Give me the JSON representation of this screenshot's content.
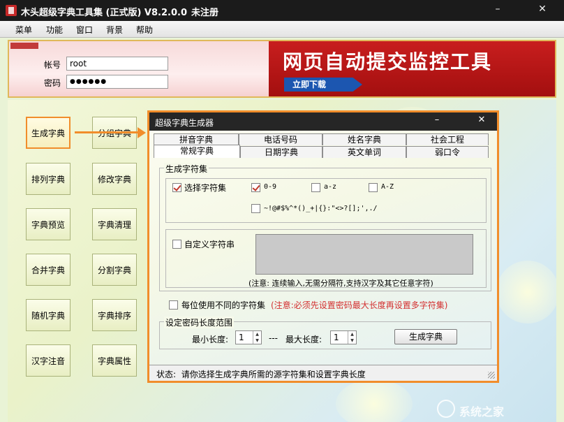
{
  "window": {
    "title": "木头超级字典工具集 (正式版) V8.2.0.0",
    "registration": "未注册",
    "min_icon": "minimize-icon",
    "close_icon": "close-icon"
  },
  "menu": {
    "items": [
      {
        "label": "菜单"
      },
      {
        "label": "功能"
      },
      {
        "label": "窗口"
      },
      {
        "label": "背景"
      },
      {
        "label": "帮助"
      }
    ]
  },
  "login": {
    "account_label": "帐号",
    "account_value": "root",
    "password_label": "密码",
    "password_value": "●●●●●●"
  },
  "ad": {
    "headline": "网页自动提交监控工具",
    "download_label": "立即下载"
  },
  "sidebar": {
    "left": [
      {
        "label": "生成字典",
        "active": true
      },
      {
        "label": "排列字典"
      },
      {
        "label": "字典预览"
      },
      {
        "label": "合并字典"
      },
      {
        "label": "随机字典"
      },
      {
        "label": "汉字注音"
      }
    ],
    "right": [
      {
        "label": "分组字典"
      },
      {
        "label": "修改字典"
      },
      {
        "label": "字典清理"
      },
      {
        "label": "分割字典"
      },
      {
        "label": "字典排序"
      },
      {
        "label": "字典属性"
      }
    ]
  },
  "dialog": {
    "title": "超级字典生成器",
    "tabs_row1": [
      {
        "label": "拼音字典"
      },
      {
        "label": "电话号码"
      },
      {
        "label": "姓名字典"
      },
      {
        "label": "社会工程"
      }
    ],
    "tabs_row2": [
      {
        "label": "常规字典",
        "active": true
      },
      {
        "label": "日期字典"
      },
      {
        "label": "英文单词"
      },
      {
        "label": "弱口令"
      }
    ],
    "charset_group": {
      "title": "生成字符集",
      "select_label": "选择字符集",
      "select_checked": true,
      "options": [
        {
          "label": "0-9",
          "checked": true
        },
        {
          "label": "a-z",
          "checked": false
        },
        {
          "label": "A-Z",
          "checked": false
        }
      ],
      "symbols": {
        "label": "~!@#$%^*()_+|{}:\"<>?[];',./",
        "checked": false
      },
      "custom_label": "自定义字符串",
      "custom_checked": false,
      "note": "(注意:  连续输入,无需分隔符,支持汉字及其它任意字符)"
    },
    "per_position": {
      "label": "每位使用不同的字符集",
      "checked": false,
      "note": "(注意:必须先设置密码最大长度再设置多字符集)"
    },
    "length_group": {
      "title": "设定密码长度范围",
      "min_label": "最小长度:",
      "min_value": "1",
      "separator": "---",
      "max_label": "最大长度:",
      "max_value": "1",
      "generate_label": "生成字典"
    },
    "status": {
      "label": "状态:",
      "text": "请你选择生成字典所需的源字符集和设置字典长度"
    }
  },
  "watermark": {
    "text": "系统之家"
  },
  "colors": {
    "accent": "#f18d2b",
    "titlebar": "#1b1b1b",
    "ad_red": "#c81e1e",
    "note_red": "#d32f2f"
  }
}
